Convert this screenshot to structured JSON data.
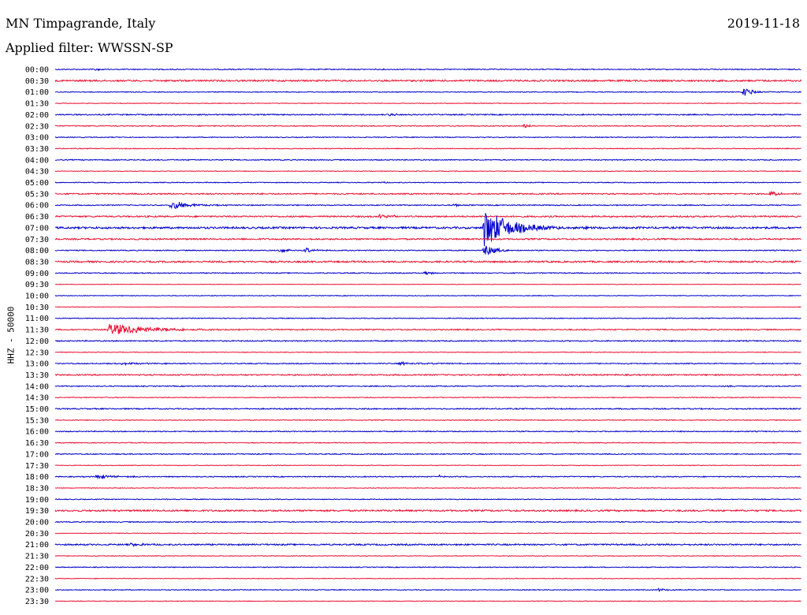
{
  "header": {
    "station": "MN Timpagrande, Italy",
    "date": "2019-11-18",
    "filter": "Applied filter: WWSSN-SP"
  },
  "colors": {
    "even_line": "#0000cc",
    "odd_line": "#ee1133"
  },
  "chart_data": {
    "type": "line",
    "title": "MN Timpagrande, Italy",
    "subtitle": "Applied filter: WWSSN-SP",
    "ylabel": "HHZ - 50000",
    "x_range_minutes": [
      0,
      30
    ],
    "traces": [
      {
        "label": "00:00",
        "noise": 0.6,
        "events": [
          {
            "t": 1.6,
            "amp": 3,
            "dur": 0.3
          }
        ]
      },
      {
        "label": "00:30",
        "noise": 1.0,
        "events": []
      },
      {
        "label": "01:00",
        "noise": 0.5,
        "events": [
          {
            "t": 27.6,
            "amp": 6,
            "dur": 0.8
          }
        ]
      },
      {
        "label": "01:30",
        "noise": 0.4,
        "events": []
      },
      {
        "label": "02:00",
        "noise": 0.7,
        "events": [
          {
            "t": 13.4,
            "amp": 2,
            "dur": 0.6
          }
        ]
      },
      {
        "label": "02:30",
        "noise": 0.6,
        "events": [
          {
            "t": 18.8,
            "amp": 3,
            "dur": 0.4
          }
        ]
      },
      {
        "label": "03:00",
        "noise": 0.5,
        "events": []
      },
      {
        "label": "03:30",
        "noise": 0.5,
        "events": []
      },
      {
        "label": "04:00",
        "noise": 0.6,
        "events": []
      },
      {
        "label": "04:30",
        "noise": 0.4,
        "events": []
      },
      {
        "label": "05:00",
        "noise": 0.5,
        "events": [
          {
            "t": 13.0,
            "amp": 1.5,
            "dur": 0.5
          }
        ]
      },
      {
        "label": "05:30",
        "noise": 0.8,
        "events": [
          {
            "t": 28.7,
            "amp": 4,
            "dur": 0.5
          }
        ]
      },
      {
        "label": "06:00",
        "noise": 0.6,
        "events": [
          {
            "t": 4.6,
            "amp": 6,
            "dur": 1.2
          },
          {
            "t": 16.0,
            "amp": 3,
            "dur": 0.3
          }
        ]
      },
      {
        "label": "06:30",
        "noise": 0.9,
        "events": [
          {
            "t": 13.0,
            "amp": 3,
            "dur": 0.8
          }
        ]
      },
      {
        "label": "07:00",
        "noise": 1.2,
        "events": [
          {
            "t": 17.2,
            "amp": 26,
            "dur": 1.6
          }
        ]
      },
      {
        "label": "07:30",
        "noise": 0.9,
        "events": []
      },
      {
        "label": "08:00",
        "noise": 0.6,
        "events": [
          {
            "t": 9.0,
            "amp": 4,
            "dur": 0.6
          },
          {
            "t": 10.0,
            "amp": 4,
            "dur": 0.6
          },
          {
            "t": 17.2,
            "amp": 10,
            "dur": 0.6
          }
        ]
      },
      {
        "label": "08:30",
        "noise": 1.0,
        "events": []
      },
      {
        "label": "09:00",
        "noise": 0.6,
        "events": [
          {
            "t": 14.8,
            "amp": 3,
            "dur": 0.6
          }
        ]
      },
      {
        "label": "09:30",
        "noise": 0.3,
        "events": []
      },
      {
        "label": "10:00",
        "noise": 0.4,
        "events": []
      },
      {
        "label": "10:30",
        "noise": 0.3,
        "events": []
      },
      {
        "label": "11:00",
        "noise": 0.5,
        "events": []
      },
      {
        "label": "11:30",
        "noise": 0.7,
        "events": [
          {
            "t": 2.1,
            "amp": 8,
            "dur": 2.6
          }
        ]
      },
      {
        "label": "12:00",
        "noise": 0.7,
        "events": []
      },
      {
        "label": "12:30",
        "noise": 0.4,
        "events": []
      },
      {
        "label": "13:00",
        "noise": 0.6,
        "events": [
          {
            "t": 2.6,
            "amp": 2,
            "dur": 1.0
          },
          {
            "t": 13.8,
            "amp": 2,
            "dur": 1.4
          }
        ]
      },
      {
        "label": "13:30",
        "noise": 0.8,
        "events": []
      },
      {
        "label": "14:00",
        "noise": 0.6,
        "events": [
          {
            "t": 27.0,
            "amp": 2,
            "dur": 0.3
          }
        ]
      },
      {
        "label": "14:30",
        "noise": 0.5,
        "events": []
      },
      {
        "label": "15:00",
        "noise": 0.7,
        "events": []
      },
      {
        "label": "15:30",
        "noise": 0.5,
        "events": []
      },
      {
        "label": "16:00",
        "noise": 0.6,
        "events": []
      },
      {
        "label": "16:30",
        "noise": 0.5,
        "events": []
      },
      {
        "label": "17:00",
        "noise": 0.6,
        "events": []
      },
      {
        "label": "17:30",
        "noise": 0.4,
        "events": []
      },
      {
        "label": "18:00",
        "noise": 0.6,
        "events": [
          {
            "t": 1.6,
            "amp": 3,
            "dur": 1.2
          },
          {
            "t": 15.4,
            "amp": 2,
            "dur": 0.3
          }
        ]
      },
      {
        "label": "18:30",
        "noise": 0.4,
        "events": []
      },
      {
        "label": "19:00",
        "noise": 0.5,
        "events": []
      },
      {
        "label": "19:30",
        "noise": 1.0,
        "events": []
      },
      {
        "label": "20:00",
        "noise": 0.6,
        "events": []
      },
      {
        "label": "20:30",
        "noise": 0.4,
        "events": []
      },
      {
        "label": "21:00",
        "noise": 0.9,
        "events": [
          {
            "t": 3.0,
            "amp": 2,
            "dur": 1.0
          }
        ]
      },
      {
        "label": "21:30",
        "noise": 0.4,
        "events": []
      },
      {
        "label": "22:00",
        "noise": 0.5,
        "events": []
      },
      {
        "label": "22:30",
        "noise": 0.4,
        "events": []
      },
      {
        "label": "23:00",
        "noise": 0.5,
        "events": [
          {
            "t": 24.2,
            "amp": 2,
            "dur": 1.0
          }
        ]
      },
      {
        "label": "23:30",
        "noise": 0.4,
        "events": []
      }
    ]
  }
}
